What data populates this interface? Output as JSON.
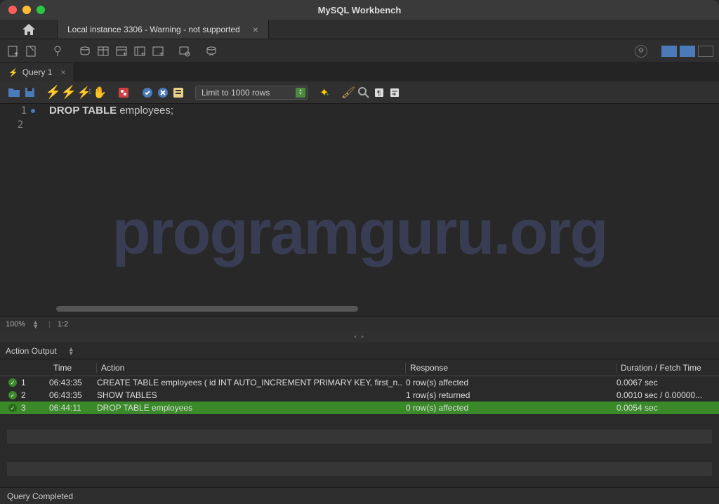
{
  "app_title": "MySQL Workbench",
  "connection_tab": "Local instance 3306 - Warning - not supported",
  "query_tab": "Query 1",
  "limit_label": "Limit to 1000 rows",
  "editor": {
    "line1": {
      "kw": "DROP TABLE",
      "rest": " employees;"
    },
    "zoom": "100%",
    "position": "1:2"
  },
  "watermark": "programguru.org",
  "output": {
    "selector": "Action Output",
    "headers": {
      "time": "Time",
      "action": "Action",
      "response": "Response",
      "duration": "Duration / Fetch Time"
    },
    "rows": [
      {
        "idx": "1",
        "time": "06:43:35",
        "action": "CREATE TABLE employees (     id INT AUTO_INCREMENT PRIMARY KEY,     first_n...",
        "response": "0 row(s) affected",
        "duration": "0.0067 sec"
      },
      {
        "idx": "2",
        "time": "06:43:35",
        "action": "SHOW TABLES",
        "response": "1 row(s) returned",
        "duration": "0.0010 sec / 0.00000..."
      },
      {
        "idx": "3",
        "time": "06:44:11",
        "action": "DROP TABLE employees",
        "response": "0 row(s) affected",
        "duration": "0.0054 sec"
      }
    ]
  },
  "status_text": "Query Completed"
}
